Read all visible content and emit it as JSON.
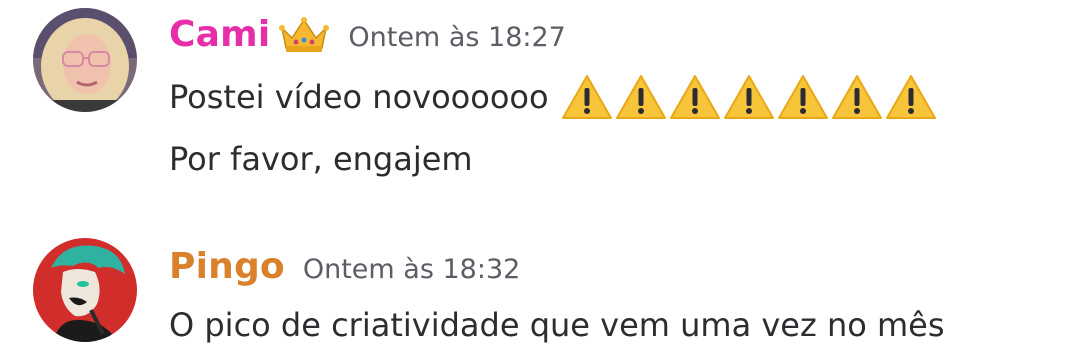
{
  "messages": [
    {
      "author": "Cami",
      "author_color": "#e62ea8",
      "badge_icon": "crown-icon",
      "timestamp": "Ontem às 18:27",
      "lines": [
        "Postei vídeo novoooooo",
        "Por favor, engajem"
      ],
      "trailing_icons": {
        "icon": "warning-icon",
        "count": 7
      }
    },
    {
      "author": "Pingo",
      "author_color": "#d9822b",
      "timestamp": "Ontem às 18:32",
      "lines": [
        "O pico de criatividade que vem uma vez no mês"
      ]
    }
  ]
}
